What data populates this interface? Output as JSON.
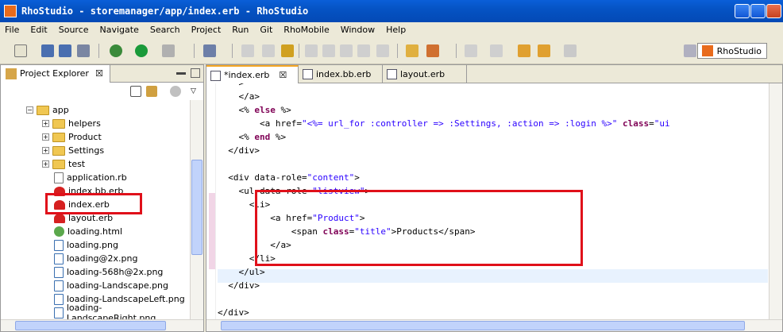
{
  "window": {
    "title": "RhoStudio - storemanager/app/index.erb - RhoStudio"
  },
  "menu": [
    "File",
    "Edit",
    "Source",
    "Navigate",
    "Search",
    "Project",
    "Run",
    "Git",
    "RhoMobile",
    "Window",
    "Help"
  ],
  "toolbar": {
    "perspective_label": "RhoStudio"
  },
  "explorer": {
    "tab_label": "Project Explorer",
    "tab_close": "☒",
    "items": [
      {
        "label": "app",
        "kind": "folder",
        "expanded": true
      },
      {
        "label": "helpers",
        "kind": "folder"
      },
      {
        "label": "Product",
        "kind": "folder"
      },
      {
        "label": "Settings",
        "kind": "folder"
      },
      {
        "label": "test",
        "kind": "folder"
      },
      {
        "label": "application.rb",
        "kind": "rb"
      },
      {
        "label": "index.bb.erb",
        "kind": "erb"
      },
      {
        "label": "index.erb",
        "kind": "erb",
        "selected": true
      },
      {
        "label": "layout.erb",
        "kind": "erb"
      },
      {
        "label": "loading.html",
        "kind": "html"
      },
      {
        "label": "loading.png",
        "kind": "png"
      },
      {
        "label": "loading@2x.png",
        "kind": "png"
      },
      {
        "label": "loading-568h@2x.png",
        "kind": "png"
      },
      {
        "label": "loading-Landscape.png",
        "kind": "png"
      },
      {
        "label": "loading-LandscapeLeft.png",
        "kind": "png"
      },
      {
        "label": "loading-LandscapeRight.png",
        "kind": "png"
      }
    ]
  },
  "editor": {
    "tabs": [
      {
        "label": "*index.erb",
        "close": "☒",
        "active": true
      },
      {
        "label": "index.bb.erb"
      },
      {
        "label": "layout.erb"
      }
    ]
  }
}
